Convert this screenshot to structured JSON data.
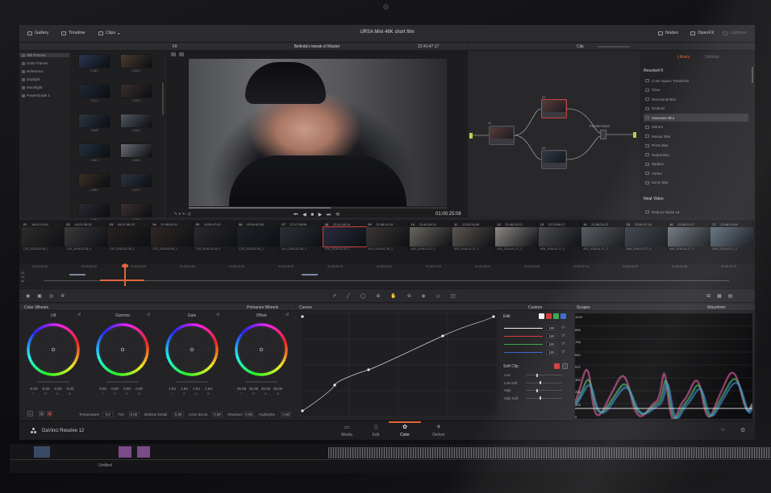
{
  "app": {
    "window_title": "URSA Mini 46K short film",
    "brand": "DaVinci Resolve 12"
  },
  "topbar": {
    "gallery": "Gallery",
    "timeline": "Timeline",
    "clips": "Clips",
    "nodes": "Nodes",
    "openfx": "OpenFX",
    "lightbox": "Lightbox"
  },
  "viewer": {
    "fit": "Fit",
    "clip_title": "Belinda's tweak of Master",
    "timecode_top": "22:41:47:17",
    "timecode": "01:00:25:08",
    "clip_mode": "Clip"
  },
  "gallery_side": {
    "items": [
      "Still Frames",
      "Grab Frames",
      "Reference",
      "Daylight",
      "Moonlight",
      "PowerGrade 1"
    ]
  },
  "stills": {
    "labels": [
      "1.18.1",
      "1.20.1",
      "1.21.1",
      "1.22.1",
      "1.ScR",
      "1.23.1",
      "1.24.1",
      "1.25.1",
      "1.26.1",
      "1.27.1",
      "1.28.1",
      "1.29.1"
    ]
  },
  "nodes": {
    "labels": [
      "01",
      "02",
      "03"
    ],
    "mixer": "Parallel Mixer"
  },
  "openfx": {
    "tab_library": "Library",
    "tab_settings": "Settings",
    "section": "ResolveFX",
    "items": [
      "Color Space Transform",
      "Glow",
      "Directional Blur",
      "Emboss",
      "Gaussian Blur",
      "Mirrors",
      "Mosaic Blur",
      "Prism Blur",
      "Radial Blur",
      "Ripples",
      "Vortex",
      "Zoom Blur"
    ],
    "selected": "Gaussian Blur",
    "section2": "Neat Video",
    "item2": "Reduce Noise v4"
  },
  "timeline": {
    "clips": [
      {
        "num": "01",
        "tc": "18:01:23:15",
        "v": "V1",
        "name": "C20_2016-02-05_1"
      },
      {
        "num": "02",
        "tc": "18:21:58:15",
        "v": "V1",
        "name": "C20_2016-02-05_1"
      },
      {
        "num": "03",
        "tc": "09:57:46:22",
        "v": "V1",
        "name": "C20_2016-02-05_1"
      },
      {
        "num": "04",
        "tc": "21:55:54:11",
        "v": "V1",
        "name": "C20_2016-02-05_1"
      },
      {
        "num": "05",
        "tc": "10:05:47:02",
        "v": "V1",
        "name": "C20_2016-02-05_1"
      },
      {
        "num": "06",
        "tc": "09:54:40:00",
        "v": "V1",
        "name": "C20_2016-02-05_1"
      },
      {
        "num": "07",
        "tc": "22:17:56:06",
        "v": "V1",
        "name": "A14_2016-01-28_1"
      },
      {
        "num": "08",
        "tc": "22:41:18:16",
        "v": "V1",
        "name": "A14_2016-01-28_2"
      },
      {
        "num": "09",
        "tc": "21:56:14:15",
        "v": "V1",
        "name": "A14_2016-01-28_1"
      },
      {
        "num": "10",
        "tc": "22:46:34:13",
        "v": "V1",
        "name": "A03_2016-01-27_1"
      },
      {
        "num": "11",
        "tc": "22:53:15:06",
        "v": "V1",
        "name": "A03_2016-01-27_1"
      },
      {
        "num": "12",
        "tc": "22:48:23:13",
        "v": "V1",
        "name": "A03_2016-01-27_2"
      },
      {
        "num": "13",
        "tc": "22:03:58:17",
        "v": "V1",
        "name": "A08_2016-01-27_1"
      },
      {
        "num": "14",
        "tc": "22:56:34:22",
        "v": "V1",
        "name": "A03_2016-01-27_2"
      },
      {
        "num": "15",
        "tc": "22:56:57:16",
        "v": "V1",
        "name": "A08_2016-01-27_2"
      },
      {
        "num": "16",
        "tc": "22:58:21:07",
        "v": "V1",
        "name": "A08_2016-01-27_2"
      },
      {
        "num": "17",
        "tc": "22:46:10:09",
        "v": "V1",
        "name": "A08_2016-01-27_2"
      }
    ]
  },
  "ruler": {
    "marks": [
      "01:00:00:00",
      "01:00:03:10",
      "01:00:06:20",
      "01:00:10:05",
      "01:00:13:15",
      "01:00:16:25",
      "01:00:20:10",
      "01:00:23:20",
      "01:00:27:05",
      "01:00:30:15",
      "01:00:34:00",
      "01:00:37:10",
      "01:00:40:20",
      "01:00:44:05",
      "01:00:47:15"
    ],
    "tracks": [
      "V2",
      "V1",
      "A1"
    ]
  },
  "wheels": {
    "panel_title": "Color Wheels",
    "mode": "Primaries Wheels",
    "items": [
      {
        "name": "Lift",
        "vals": [
          "-0.02",
          "-0.02",
          "-0.02",
          "-0.02"
        ]
      },
      {
        "name": "Gamma",
        "vals": [
          "0.00",
          "0.00",
          "0.00",
          "0.00"
        ]
      },
      {
        "name": "Gain",
        "vals": [
          "1.54",
          "1.54",
          "1.54",
          "1.54"
        ]
      },
      {
        "name": "Offset",
        "vals": [
          "25.00",
          "25.00",
          "25.00",
          "25.00"
        ]
      }
    ],
    "channels": [
      "Y",
      "R",
      "G",
      "B"
    ],
    "bottom": [
      {
        "label": "Temperature",
        "val": "0.0"
      },
      {
        "label": "Tint",
        "val": "0.00"
      },
      {
        "label": "Midtone Detail",
        "val": "0.00"
      },
      {
        "label": "Color Boost",
        "val": "0.00"
      },
      {
        "label": "Shadows",
        "val": "0.00"
      },
      {
        "label": "Highlights",
        "val": "0.00"
      }
    ],
    "pages": [
      "A",
      "1",
      "2"
    ]
  },
  "curves": {
    "title": "Curves",
    "mode": "Custom"
  },
  "edit": {
    "title": "Edit",
    "values": [
      "100",
      "100",
      "100",
      "100"
    ],
    "soft_clip": "Soft Clip",
    "soft_items": [
      "Low",
      "Low Soft",
      "High",
      "High Soft"
    ]
  },
  "scopes": {
    "title": "Scopes",
    "mode": "Waveform",
    "scale": [
      "1023",
      "896",
      "768",
      "640",
      "512",
      "384",
      "256",
      "128",
      "0"
    ]
  },
  "pages": {
    "items": [
      "Media",
      "Edit",
      "Color",
      "Deliver"
    ],
    "active": "Color"
  },
  "below": {
    "untitled": "Untitled"
  },
  "colors": {
    "accent_orange": "#e0663a",
    "select_red": "#cf4040",
    "node_green": "#b3d34a"
  }
}
